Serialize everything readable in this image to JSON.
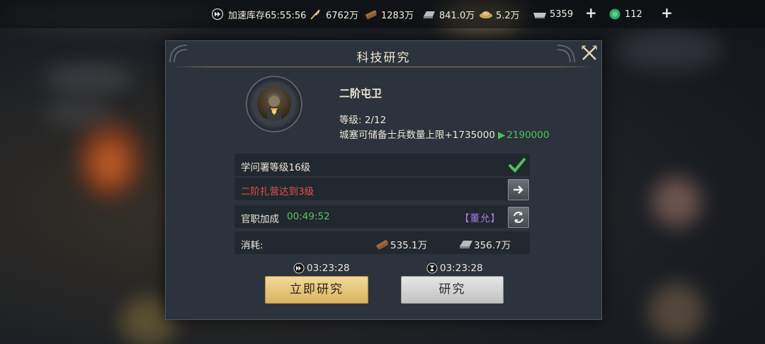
{
  "topbar": {
    "speed_storage": "加速库存65:55:56",
    "food": "6762万",
    "wood": "1283万",
    "iron": "841.0万",
    "silver": "5.2万",
    "ingot": "5359",
    "jade": "112"
  },
  "dialog": {
    "title": "科技研究",
    "tech_name": "二阶屯卫",
    "level": "等级: 2/12",
    "effect": "城塞可储备士兵数量上限+1735000",
    "effect_next": "2190000",
    "requirements": [
      {
        "text": "学问署等级16级",
        "met": true
      },
      {
        "text": "二阶扎营达到3级",
        "met": false
      }
    ],
    "official_label": "官职加成",
    "official_timer": "00:49:52",
    "official_name": "【董允】",
    "cost_label": "消耗:",
    "cost_wood": "535.1万",
    "cost_iron": "356.7万",
    "instant_time": "03:23:28",
    "research_time": "03:23:28",
    "instant_button": "立即研究",
    "research_button": "研究"
  },
  "colors": {
    "accent_green": "#57c463",
    "warn_red": "#e0524c",
    "official_purple": "#a878e6",
    "gold_button": "#e6c57a"
  }
}
